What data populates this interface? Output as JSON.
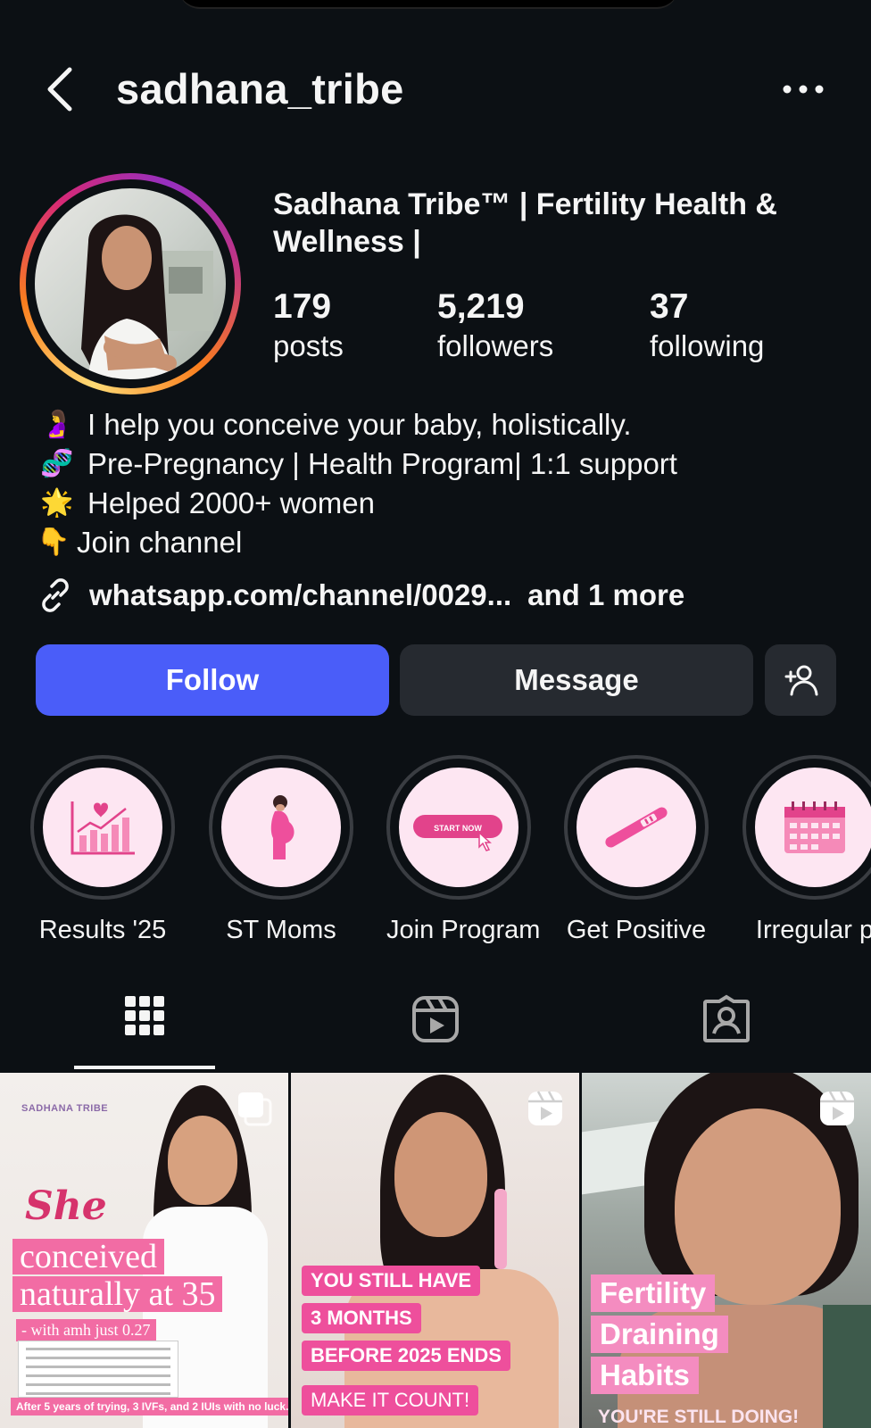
{
  "header": {
    "username": "sadhana_tribe"
  },
  "profile": {
    "display_name": "Sadhana Tribe™ | Fertility Health & Wellness |",
    "stats": [
      {
        "value": "179",
        "label": "posts"
      },
      {
        "value": "5,219",
        "label": "followers"
      },
      {
        "value": "37",
        "label": "following"
      }
    ],
    "bio": [
      {
        "icon": "pregnant-woman-emoji",
        "glyph": "🤰",
        "text": "I help you conceive your baby, holistically."
      },
      {
        "icon": "dna-emoji",
        "glyph": "🧬",
        "text": "Pre-Pregnancy | Health Program| 1:1 support"
      },
      {
        "icon": "star-emoji",
        "glyph": "🌟",
        "text": "Helped 2000+ women"
      },
      {
        "icon": "pointing-down-emoji",
        "glyph": "👇",
        "text": "Join channel"
      }
    ],
    "link": {
      "url": "whatsapp.com/channel/0029...",
      "more": "and 1 more"
    }
  },
  "actions": {
    "follow": "Follow",
    "message": "Message"
  },
  "highlights": [
    {
      "label": "Results '25",
      "icon": "growth-chart-heart-icon"
    },
    {
      "label": "ST Moms",
      "icon": "pregnant-woman-icon"
    },
    {
      "label": "Join Program",
      "icon": "start-now-button-icon",
      "badge_text": "START NOW"
    },
    {
      "label": "Get Positive",
      "icon": "pregnancy-test-icon"
    },
    {
      "label": "Irregular p",
      "icon": "calendar-icon"
    }
  ],
  "tabs": [
    "grid-tab",
    "reels-tab",
    "tagged-tab"
  ],
  "posts": [
    {
      "type": "carousel",
      "brand": "SADHANA TRIBE",
      "lines": [
        "She",
        "conceived",
        "naturally at 35",
        "- with amh just 0.27"
      ],
      "caption": "After 5 years of trying, 3 IVFs, and 2 IUIs with no luck."
    },
    {
      "type": "reel",
      "lines": [
        "YOU STILL HAVE",
        "3 MONTHS",
        "BEFORE 2025 ENDS",
        "MAKE IT COUNT!"
      ]
    },
    {
      "type": "reel",
      "lines": [
        "Fertility",
        "Draining",
        "Habits",
        "YOU'RE STILL DOING!"
      ]
    }
  ],
  "colors": {
    "background": "#0c1014",
    "follow_button": "#4a5df9",
    "secondary_button": "#262a30",
    "highlight_disc": "#fde6f2"
  }
}
